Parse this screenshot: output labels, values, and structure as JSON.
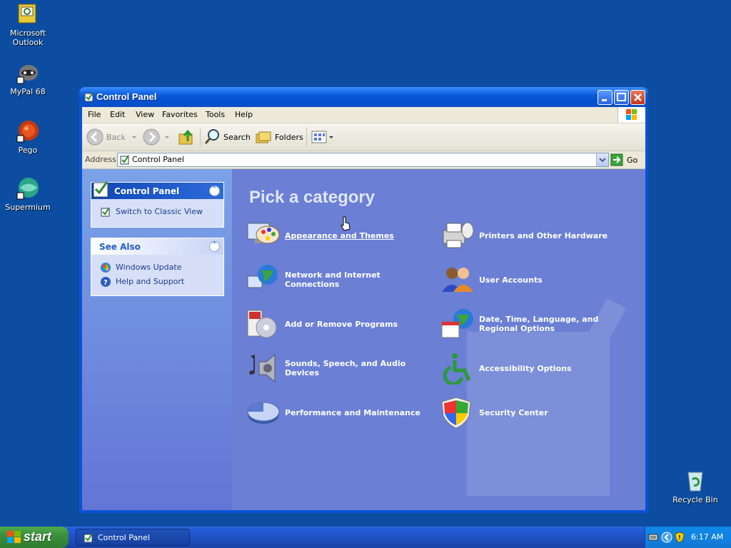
{
  "desktop": {
    "icons": [
      {
        "label": "Microsoft Outlook"
      },
      {
        "label": "MyPal 68"
      },
      {
        "label": "Pego"
      },
      {
        "label": "Supermium"
      },
      {
        "label": "Recycle Bin"
      }
    ]
  },
  "window": {
    "title": "Control Panel",
    "menu": [
      "File",
      "Edit",
      "View",
      "Favorites",
      "Tools",
      "Help"
    ],
    "toolbar": {
      "back_label": "Back",
      "search_label": "Search",
      "folders_label": "Folders"
    },
    "address": {
      "label": "Address",
      "value": "Control Panel",
      "go_label": "Go"
    },
    "left_pane": {
      "control_panel_box": {
        "title": "Control Panel",
        "links": [
          "Switch to Classic View"
        ]
      },
      "see_also_box": {
        "title": "See Also",
        "links": [
          "Windows Update",
          "Help and Support"
        ]
      }
    },
    "main": {
      "heading": "Pick a category",
      "categories": [
        {
          "label": "Appearance and Themes",
          "icon": "appearance-themes-icon"
        },
        {
          "label": "Printers and Other Hardware",
          "icon": "printer-icon"
        },
        {
          "label": "Network and Internet Connections",
          "icon": "network-globe-icon"
        },
        {
          "label": "User Accounts",
          "icon": "user-accounts-icon"
        },
        {
          "label": "Add or Remove Programs",
          "icon": "add-remove-programs-icon"
        },
        {
          "label": "Date, Time, Language, and Regional Options",
          "icon": "date-time-globe-icon"
        },
        {
          "label": "Sounds, Speech, and Audio Devices",
          "icon": "speaker-icon"
        },
        {
          "label": "Accessibility Options",
          "icon": "accessibility-icon"
        },
        {
          "label": "Performance and Maintenance",
          "icon": "pie-chart-icon"
        },
        {
          "label": "Security Center",
          "icon": "shield-icon"
        }
      ]
    }
  },
  "taskbar": {
    "start_label": "start",
    "open_window_label": "Control Panel",
    "clock": "6:17 AM"
  },
  "colors": {
    "desktop_bg": "#0d4da1",
    "title_bar": "#0a5bdb",
    "category_pane": "#6b7fd4",
    "start_green": "#3c8f3c"
  }
}
